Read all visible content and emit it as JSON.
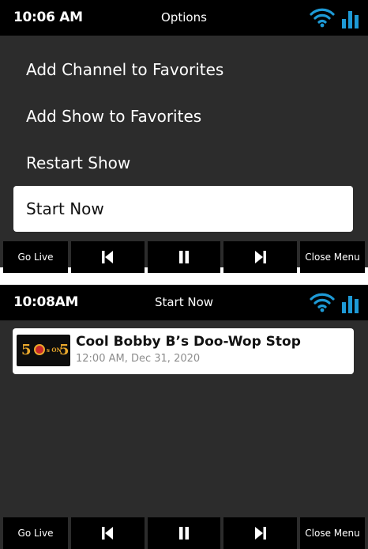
{
  "colors": {
    "accent": "#1e9ad6",
    "selected_bg": "#ffffff",
    "screen_bg": "#2c2c2c",
    "bar_bg": "#000000"
  },
  "screens": [
    {
      "status": {
        "time": "10:06 AM",
        "title": "Options",
        "wifi_icon": "wifi-icon",
        "signal_icon": "signal-bars-icon"
      },
      "menu": [
        {
          "label": "Add Channel to Favorites",
          "selected": false
        },
        {
          "label": "Add Show to Favorites",
          "selected": false
        },
        {
          "label": "Restart Show",
          "selected": false
        },
        {
          "label": "Start Now",
          "selected": true
        }
      ],
      "toolbar": {
        "go_live": "Go Live",
        "prev_icon": "skip-back-icon",
        "pause_icon": "pause-icon",
        "next_icon": "skip-forward-icon",
        "close_menu": "Close Menu"
      }
    },
    {
      "status": {
        "time": "10:08AM",
        "title": "Start Now",
        "wifi_icon": "wifi-icon",
        "signal_icon": "signal-bars-icon"
      },
      "show": {
        "title": "Cool Bobby B’s Doo-Wop Stop",
        "time": "12:00 AM, Dec 31, 2020",
        "logo_text_left": "5",
        "logo_text_small": "s ON",
        "logo_text_right": "5"
      },
      "toolbar": {
        "go_live": "Go Live",
        "prev_icon": "skip-back-icon",
        "pause_icon": "pause-icon",
        "next_icon": "skip-forward-icon",
        "close_menu": "Close Menu"
      }
    }
  ]
}
